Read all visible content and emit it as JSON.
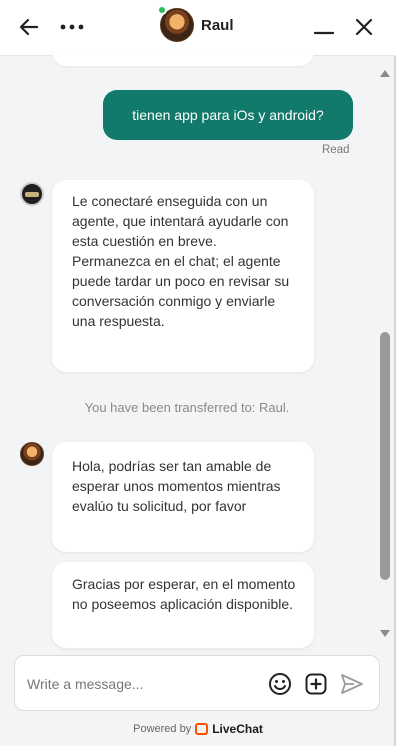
{
  "header": {
    "agent_name": "Raul",
    "colors": {
      "online": "#2ebd59"
    }
  },
  "messages": {
    "outgoing_1": "tienen app para iOs y android?",
    "read_label": "Read",
    "bot_1": "Le conectaré enseguida con un agente, que intentará ayudarle con esta cuestión en breve. Permanezca en el chat; el agente puede tardar un poco en revisar su conversación conmigo y enviarle una respuesta.",
    "system_note": "You have been transferred to: Raul.",
    "agent_1": "Hola, podrías ser tan amable de esperar unos momentos mientras evalúo tu solicitud, por favor",
    "agent_2": "Gracias por esperar, en el momento no poseemos aplicación disponible."
  },
  "composer": {
    "placeholder": "Write a message..."
  },
  "footer": {
    "powered_by": "Powered by",
    "brand": "LiveChat"
  },
  "colors": {
    "outgoing_bubble": "#127a6a",
    "brand_orange": "#ff5100"
  },
  "icons": [
    "back-arrow-icon",
    "more-icon",
    "minimize-icon",
    "close-icon",
    "emoji-icon",
    "attach-icon",
    "send-icon",
    "livechat-logo-icon"
  ]
}
